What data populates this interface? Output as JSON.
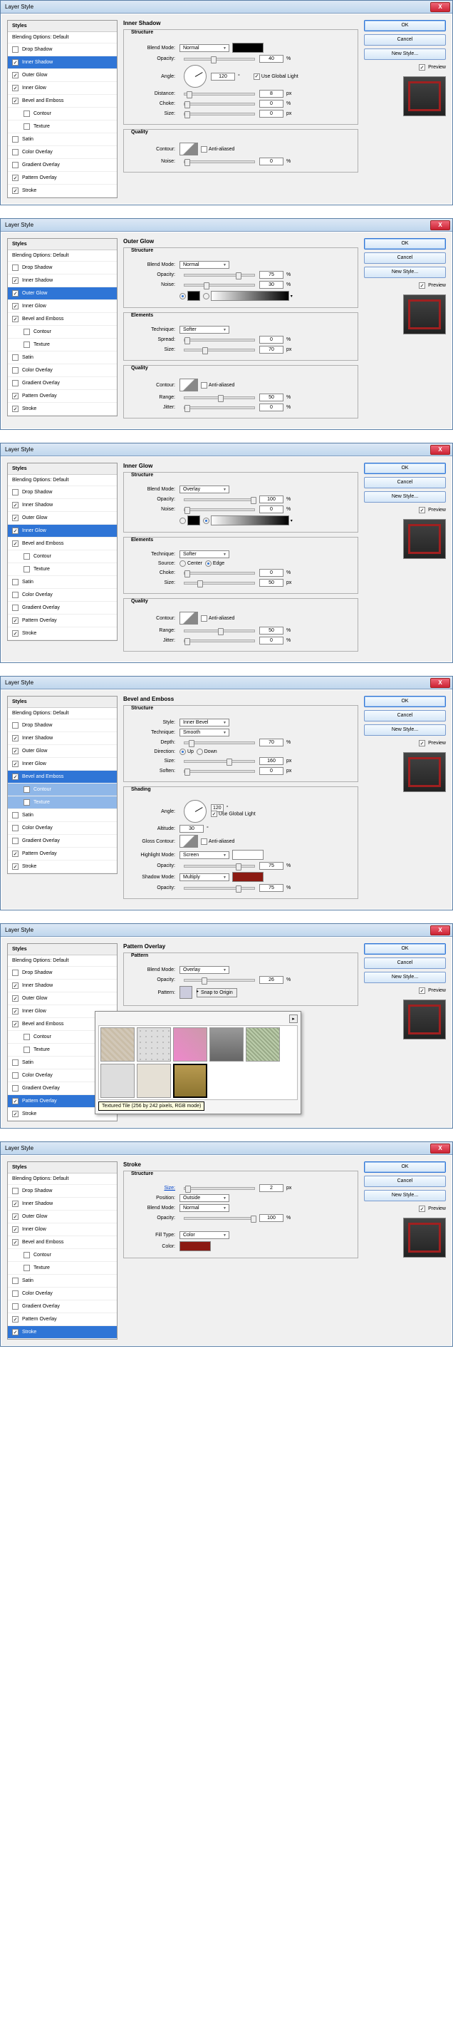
{
  "common": {
    "title": "Layer Style",
    "ok": "OK",
    "cancel": "Cancel",
    "new_style": "New Style...",
    "preview": "Preview",
    "close": "X",
    "styles_hdr": "Styles",
    "blending_opts": "Blending Options: Default",
    "drop_shadow": "Drop Shadow",
    "inner_shadow": "Inner Shadow",
    "outer_glow": "Outer Glow",
    "inner_glow": "Inner Glow",
    "bevel_emboss": "Bevel and Emboss",
    "contour": "Contour",
    "texture": "Texture",
    "satin": "Satin",
    "color_overlay": "Color Overlay",
    "gradient_overlay": "Gradient Overlay",
    "pattern_overlay": "Pattern Overlay",
    "stroke": "Stroke",
    "structure": "Structure",
    "quality": "Quality",
    "elements": "Elements",
    "shading": "Shading",
    "blend_mode": "Blend Mode:",
    "opacity": "Opacity:",
    "angle": "Angle:",
    "distance": "Distance:",
    "choke": "Choke:",
    "size": "Size:",
    "noise": "Noise:",
    "spread": "Spread:",
    "technique": "Technique:",
    "source": "Source:",
    "center": "Center",
    "edge": "Edge",
    "range": "Range:",
    "jitter": "Jitter:",
    "contour_lbl": "Contour:",
    "antialias": "Anti-aliased",
    "use_global": "Use Global Light",
    "style_lbl": "Style:",
    "depth": "Depth:",
    "direction": "Direction:",
    "up": "Up",
    "down": "Down",
    "soften": "Soften:",
    "altitude": "Altitude:",
    "gloss_contour": "Gloss Contour:",
    "highlight_mode": "Highlight Mode:",
    "shadow_mode": "Shadow Mode:",
    "pattern_lbl": "Pattern:",
    "snap": "Snap to Origin",
    "position": "Position:",
    "fill_type": "Fill Type:",
    "color_lbl": "Color:",
    "px": "px",
    "pct": "%",
    "deg": "°"
  },
  "d1": {
    "sel": "inner_shadow",
    "mode": "Normal",
    "opacity": "40",
    "angle": "120",
    "distance": "8",
    "choke": "0",
    "size": "0",
    "noise": "0"
  },
  "d2": {
    "sel": "outer_glow",
    "mode": "Normal",
    "opacity": "75",
    "noise": "30",
    "technique": "Softer",
    "spread": "0",
    "size": "70",
    "range": "50",
    "jitter": "0"
  },
  "d3": {
    "sel": "inner_glow",
    "mode": "Overlay",
    "opacity": "100",
    "noise": "0",
    "technique": "Softer",
    "choke": "0",
    "size": "50",
    "range": "50",
    "jitter": "0"
  },
  "d4": {
    "sel": "bevel_emboss",
    "title": "Bevel and Emboss",
    "style": "Inner Bevel",
    "technique": "Smooth",
    "depth": "70",
    "size": "160",
    "soften": "0",
    "angle": "120",
    "altitude": "30",
    "hmode": "Screen",
    "hopacity": "75",
    "smode": "Multiply",
    "sopacity": "75"
  },
  "d5": {
    "sel": "pattern_overlay",
    "mode": "Overlay",
    "opacity": "26",
    "tooltip": "Textured Tile (256 by 242 pixels, RGB mode)"
  },
  "d6": {
    "sel": "stroke",
    "title": "Stroke",
    "size": "2",
    "position": "Outside",
    "mode": "Normal",
    "opacity": "100",
    "filltype": "Color"
  }
}
